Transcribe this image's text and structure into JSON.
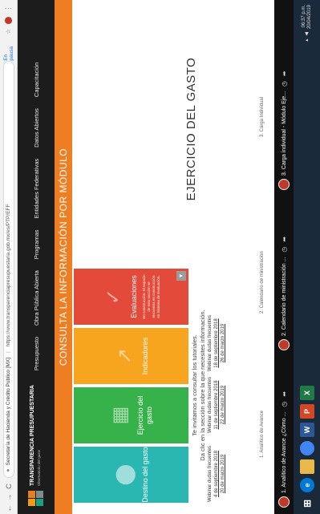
{
  "browser": {
    "back": "←",
    "forward": "→",
    "reload": "C",
    "org_label": "Secretaría de Hacienda y Crédito Público [MX]",
    "url": "https://www.transparenciapresupuestaria.gob.mx/es/PTP/EFF",
    "pause_label": "En pausa"
  },
  "site": {
    "logo_title": "TRANSPARENCIA PRESUPUESTARIA",
    "logo_subtitle": "Observatorio del gasto",
    "nav": [
      "Presupuesto",
      "Obra Pública Abierta",
      "Programas",
      "Entidades Federativas",
      "Datos Abiertos",
      "Capacitación"
    ],
    "banner": "CONSULTA LA INFORMACIÓN POR MÓDULO"
  },
  "cards": [
    {
      "title": "Destino del gasto"
    },
    {
      "title": "Ejercicio del gasto"
    },
    {
      "title": "Indicadores"
    },
    {
      "title": "Evaluaciones",
      "note": "En construcción. El espacio de esta sección se encuentra en construcción en Sistema de Evaluación."
    }
  ],
  "intro": {
    "line1": "Te invitamos a consultar los tutoriales.",
    "line2": "Da clic en la sección sobre la que necesites información."
  },
  "webinars": [
    {
      "label": "Webinar dudas frecuentes",
      "date1": "4 de septiembre 2018",
      "date2": "20 de marzo 2019"
    },
    {
      "label": "Webinar dudas frecuentes",
      "date1": "11 de septiembre 2018",
      "date2": "22 de marzo 2019"
    },
    {
      "label": "Webinar dudas frecuentes",
      "date1": "18 de septiembre 2018",
      "date2": "26 de marzo 2019"
    }
  ],
  "section_title": "EJERCICIO DEL GASTO",
  "tutorial_labels": [
    "1. Analítico de Avance",
    "2. Calendario de ministración",
    "3. Carga Individual"
  ],
  "videos": [
    {
      "title": "1. Analítico de Avance ¿Cómo ..."
    },
    {
      "title": "2. Calendario de ministración ..."
    },
    {
      "title": "3. Carga individual - Módulo Eje..."
    }
  ],
  "taskbar": {
    "time": "06:37 p.m.",
    "date": "20/04/2019"
  },
  "colors": {
    "banner": "#ef7d22",
    "destino": "#2bb7b1",
    "ejercicio": "#37b14a",
    "indicadores": "#f7a51e",
    "evaluaciones": "#e34a3a"
  }
}
